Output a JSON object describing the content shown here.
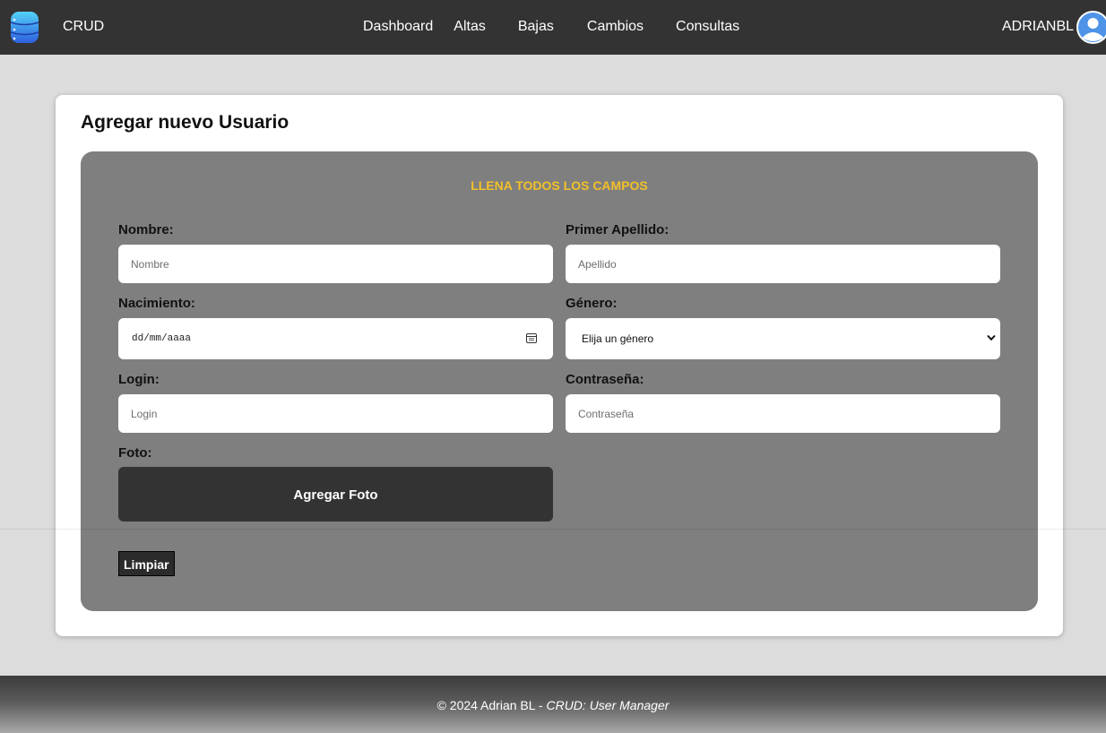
{
  "navbar": {
    "brand": "CRUD",
    "brand_icon": "database-icon",
    "links": [
      "Dashboard",
      "Altas",
      "Bajas",
      "Cambios",
      "Consultas"
    ],
    "user": "ADRIANBL",
    "user_icon": "user-avatar-icon"
  },
  "page": {
    "title": "Agregar nuevo Usuario"
  },
  "form": {
    "header": "LLENA TODOS LOS CAMPOS",
    "nombre_label": "Nombre:",
    "nombre_placeholder": "Nombre",
    "apellido_label": "Primer Apellido:",
    "apellido_placeholder": "Apellido",
    "nacimiento_label": "Nacimiento:",
    "nacimiento_value": "dd/mm/aaaa",
    "genero_label": "Género:",
    "genero_value": "Elija un género",
    "login_label": "Login:",
    "login_placeholder": "Login",
    "password_label": "Contraseña:",
    "password_placeholder": "Contraseña",
    "foto_label": "Foto:",
    "foto_button": "Agregar Foto",
    "clear_button": "Limpiar"
  },
  "footer": {
    "prefix": "© 2024 Adrian BL - ",
    "app": "CRUD: User Manager"
  },
  "colors": {
    "navbar": "#333333",
    "panel": "#7f7f7f",
    "accent": "#f2c029"
  }
}
